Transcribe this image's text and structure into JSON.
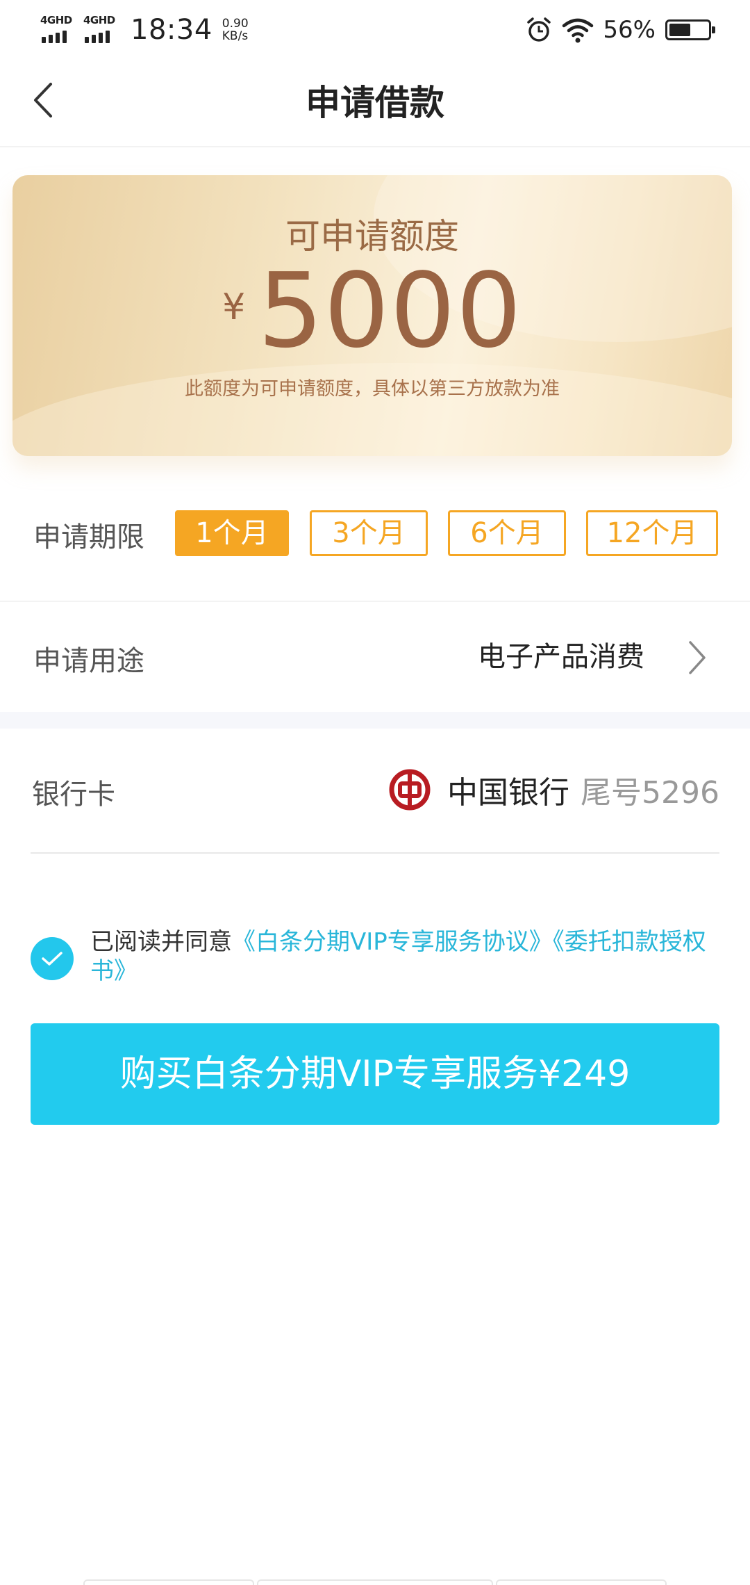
{
  "status_bar": {
    "network_1": "4GHD",
    "network_2": "4GHD",
    "time": "18:34",
    "speed_value": "0.90",
    "speed_unit": "KB/s",
    "battery_percent": "56%",
    "battery_level": 0.56,
    "icons": [
      "signal-icon",
      "alarm-icon",
      "wifi-icon",
      "battery-icon"
    ]
  },
  "nav": {
    "title": "申请借款",
    "back_icon": "chevron-left-icon"
  },
  "quota": {
    "title": "可申请额度",
    "currency": "¥",
    "amount": "5000",
    "note": "此额度为可申请额度，具体以第三方放款为准"
  },
  "term": {
    "label": "申请期限",
    "options": [
      "1个月",
      "3个月",
      "6个月",
      "12个月"
    ],
    "selected": "1个月"
  },
  "purpose": {
    "label": "申请用途",
    "value": "电子产品消费"
  },
  "bank": {
    "label": "银行卡",
    "name": "中国银行",
    "tail": "尾号5296"
  },
  "agreement": {
    "checked": true,
    "prefix": "已阅读并同意",
    "link_1": "《白条分期VIP专享服务协议》",
    "link_2": "《委托扣款授权书》"
  },
  "buy_button": {
    "label": "购买白条分期VIP专享服务¥249"
  },
  "colors": {
    "accent_orange": "#f5a623",
    "accent_cyan": "#22cbee",
    "link_cyan": "#29b6d9",
    "card_brown": "#9a6443",
    "boc_red": "#b81c22"
  }
}
